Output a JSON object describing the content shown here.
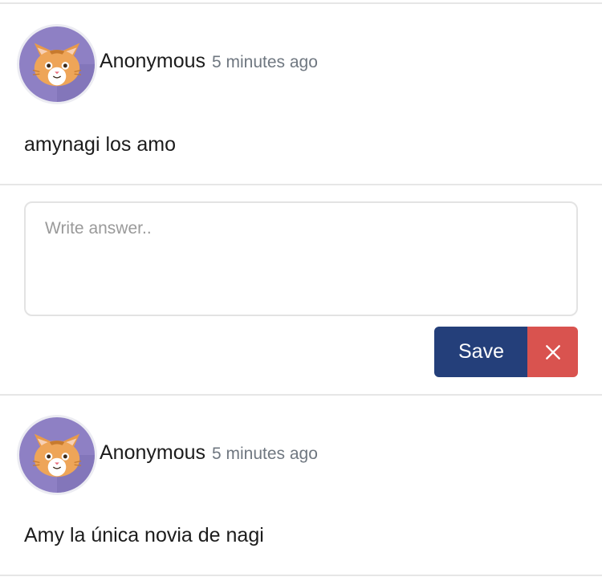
{
  "comments": [
    {
      "author": "Anonymous",
      "time": "5 minutes ago",
      "text": "amynagi los amo",
      "avatar_icon": "cat-avatar-icon"
    },
    {
      "author": "Anonymous",
      "time": "5 minutes ago",
      "text": "Amy la única novia de nagi",
      "avatar_icon": "cat-avatar-icon"
    }
  ],
  "reply_form": {
    "placeholder": "Write answer..",
    "value": "",
    "save_label": "Save",
    "close_icon": "close-icon"
  },
  "colors": {
    "save_button": "#243f7a",
    "close_button": "#d9534f",
    "avatar_bg": "#8e80c4",
    "timestamp": "#6f7780"
  }
}
